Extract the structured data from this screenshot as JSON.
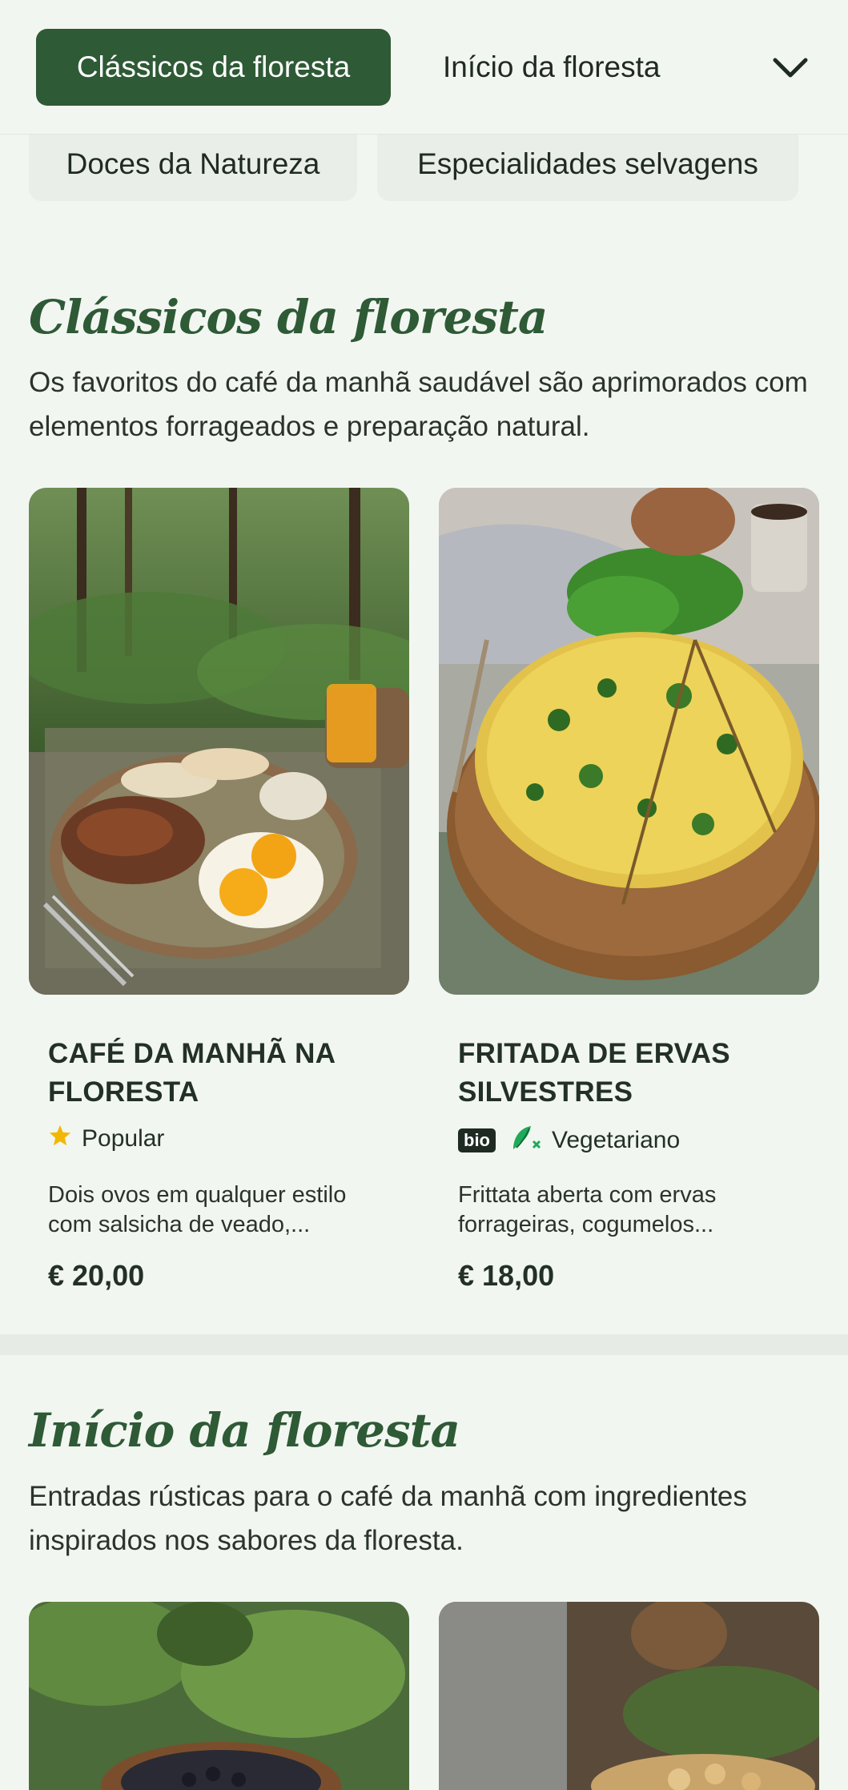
{
  "nav": {
    "active_tab": "Clássicos da floresta",
    "next_tab": "Início da floresta",
    "chips": [
      "Doces da Natureza",
      "Especialidades selvagens"
    ]
  },
  "sections": [
    {
      "title": "Clássicos da floresta",
      "description": "Os favoritos do café da manhã saudável são aprimorados com elementos forrageados e preparação natural.",
      "items": [
        {
          "title": "CAFÉ DA MANHÃ NA FLORESTA",
          "tag": "Popular",
          "tag_icon": "star-icon",
          "description": "Dois ovos em qualquer estilo com salsicha de veado,...",
          "price": "€ 20,00"
        },
        {
          "title": "FRITADA DE ERVAS SILVESTRES",
          "badge": "bio",
          "tag": "Vegetariano",
          "tag_icon": "vegetarian-icon",
          "description": "Frittata aberta com ervas forrageiras, cogumelos...",
          "price": "€ 18,00"
        }
      ]
    },
    {
      "title": "Início da floresta",
      "description": "Entradas rústicas para o café da manhã com ingredientes inspirados nos sabores da floresta."
    }
  ],
  "colors": {
    "accent": "#2e5a36",
    "background": "#f2f6f1",
    "chip": "#e9eee8",
    "star": "#f2b705",
    "vegetarian": "#1faa59"
  }
}
